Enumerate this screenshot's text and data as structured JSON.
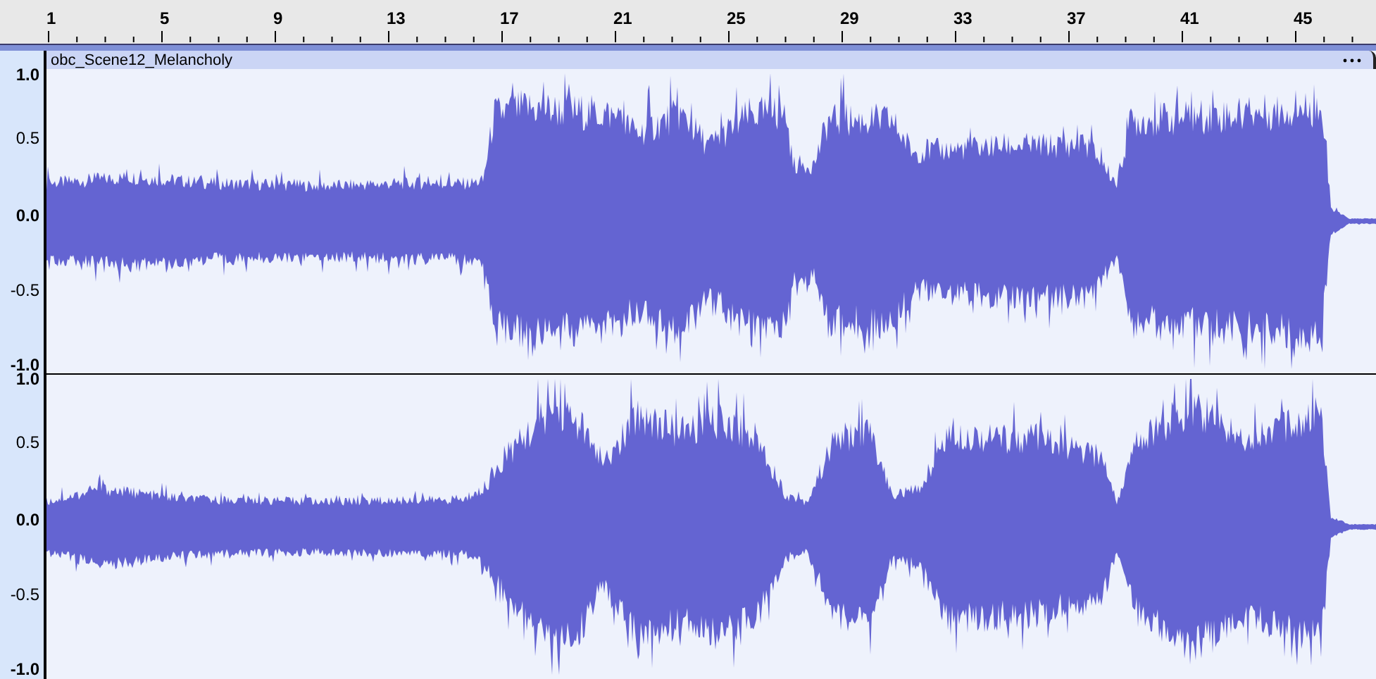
{
  "ruler": {
    "labels": [
      "1",
      "5",
      "9",
      "13",
      "17",
      "21",
      "25",
      "29",
      "33",
      "37",
      "41",
      "45"
    ]
  },
  "track": {
    "clip_name": "obc_Scene12_Melancholy",
    "channels": [
      {
        "axis_labels": [
          "1.0",
          "0.5",
          "0.0",
          "-0.5",
          "-1.0"
        ]
      },
      {
        "axis_labels": [
          "1.0",
          "0.5",
          "0.0",
          "-0.5",
          "-1.0"
        ]
      }
    ]
  }
}
